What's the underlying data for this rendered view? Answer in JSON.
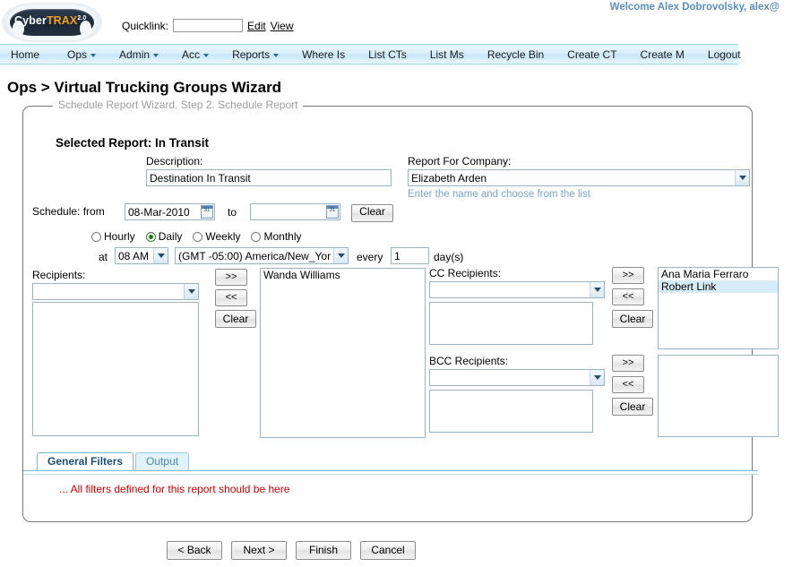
{
  "header": {
    "logo": {
      "part1": "Cyber",
      "part2": "TRAX",
      "version": "2.0"
    },
    "quicklink_label": "Quicklink:",
    "quicklink_value": "",
    "quicklink_placeholder": "",
    "edit_link": "Edit",
    "view_link": "View",
    "welcome": "Welcome Alex Dobrovolsky, alex@"
  },
  "nav": {
    "items": [
      {
        "label": "Home",
        "has_caret": false
      },
      {
        "label": "Ops",
        "has_caret": true
      },
      {
        "label": "Admin",
        "has_caret": true
      },
      {
        "label": "Acc",
        "has_caret": true
      },
      {
        "label": "Reports",
        "has_caret": true
      },
      {
        "label": "Where Is",
        "has_caret": false
      },
      {
        "label": "List CTs",
        "has_caret": false
      },
      {
        "label": "List Ms",
        "has_caret": false
      },
      {
        "label": "Recycle Bin",
        "has_caret": false
      },
      {
        "label": "Create CT",
        "has_caret": false
      },
      {
        "label": "Create M",
        "has_caret": false
      },
      {
        "label": "Logout",
        "has_caret": false
      }
    ]
  },
  "page": {
    "title": "Ops > Virtual Trucking Groups Wizard",
    "legend": "Schedule Report Wizard. Step 2. Schedule Report",
    "selected_report": "Selected Report: In Transit"
  },
  "form": {
    "description_label": "Description:",
    "description_value": "Destination In Transit",
    "company_label": "Report For Company:",
    "company_value": "Elizabeth Arden",
    "company_hint": "Enter the name and choose from the list",
    "schedule_label": "Schedule: from",
    "date_from": "08-Mar-2010",
    "to_word": "to",
    "date_to": "",
    "clear_date_label": "Clear",
    "frequency_options": [
      {
        "label": "Hourly",
        "selected": false
      },
      {
        "label": "Daily",
        "selected": true
      },
      {
        "label": "Weekly",
        "selected": false
      },
      {
        "label": "Monthly",
        "selected": false
      }
    ],
    "at_word": "at",
    "time_value": "08 AM",
    "timezone_value": "(GMT -05:00) America/New_Yor",
    "every_word": "every",
    "every_value": "1",
    "days_word": "day(s)"
  },
  "recipients": {
    "label": "Recipients:",
    "combo_value": "",
    "source_list": [],
    "selected_list": [
      {
        "text": "Wanda Williams",
        "selected": false
      }
    ],
    "add_label": ">>",
    "remove_label": "<<",
    "clear_label": "Clear"
  },
  "cc": {
    "label": "CC Recipients:",
    "combo_value": "",
    "source_list": [],
    "selected_list": [
      {
        "text": "Ana Maria Ferraro",
        "selected": false
      },
      {
        "text": "Robert Link",
        "selected": true
      }
    ],
    "add_label": ">>",
    "remove_label": "<<",
    "clear_label": "Clear"
  },
  "bcc": {
    "label": "BCC Recipients:",
    "combo_value": "",
    "source_list": [],
    "selected_list": [],
    "add_label": ">>",
    "remove_label": "<<",
    "clear_label": "Clear"
  },
  "tabs": [
    {
      "label": "General Filters",
      "active": true
    },
    {
      "label": "Output",
      "active": false
    }
  ],
  "filters_note": "... All filters defined for this report should be here",
  "bottom_buttons": [
    {
      "label": "< Back"
    },
    {
      "label": "Next >"
    },
    {
      "label": "Finish"
    },
    {
      "label": "Cancel"
    }
  ],
  "colors": {
    "accent": "#5a8fc0",
    "nav": "#c6e6f8",
    "error_text": "#cc0000",
    "hint_text": "#79a5c8",
    "logo_orange": "#f0a020"
  }
}
